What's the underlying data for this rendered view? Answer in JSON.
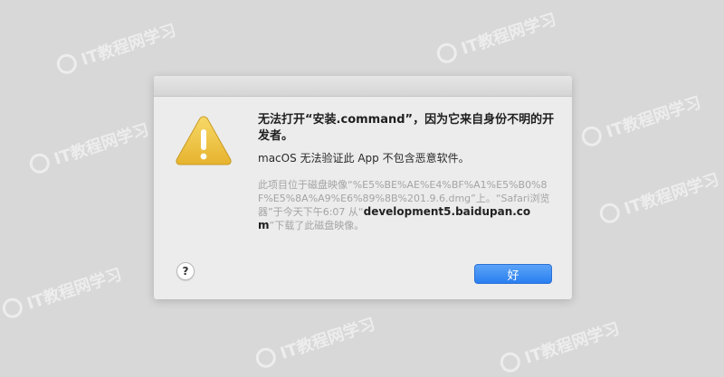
{
  "watermark": {
    "text": "IT教程网学习"
  },
  "dialog": {
    "title": "无法打开“安装.command”，因为它来自身份不明的开发者。",
    "message": "macOS 无法验证此 App 不包含恶意软件。",
    "info": {
      "prefix": "此项目位于磁盘映像“%E5%BE%AE%E4%BF%A1%E5%B0%8F%E5%8A%A9%E6%89%8B%201.9.6.dmg”上。“Safari浏览器”于今天下午6:07 从“",
      "host": "development5.baidupan.com",
      "suffix": "”下载了此磁盘映像。"
    },
    "help_label": "?",
    "ok_label": "好",
    "icon": "warning-icon"
  },
  "colors": {
    "background": "#d8d8d8",
    "dialog": "#ececec",
    "accent": "#2a7ff0",
    "warning": "#f2c94c"
  }
}
